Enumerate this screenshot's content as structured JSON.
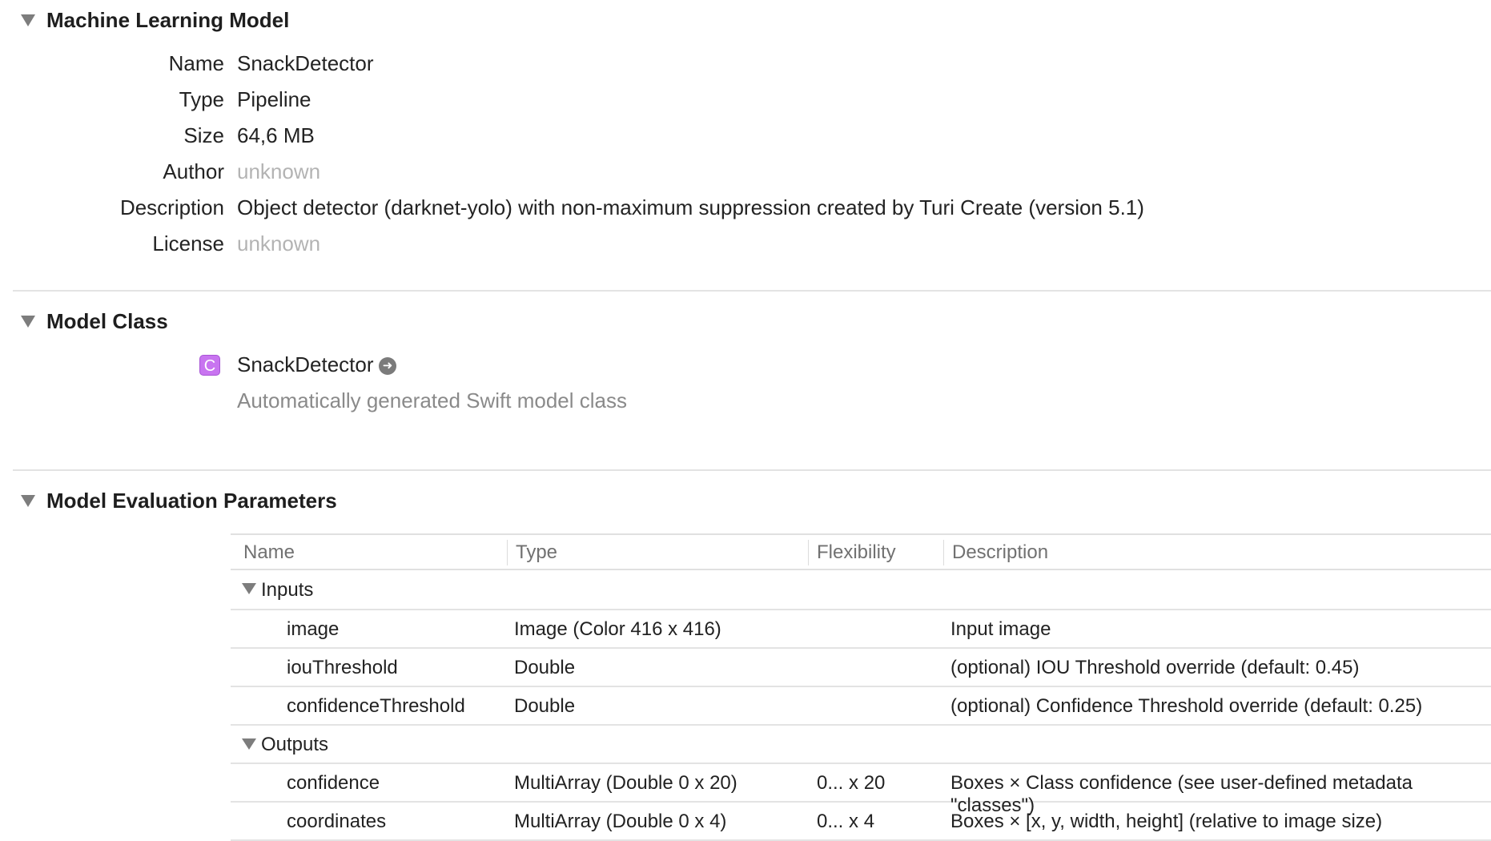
{
  "sections": {
    "ml_model": {
      "title": "Machine Learning Model",
      "rows": [
        {
          "label": "Name",
          "value": "SnackDetector"
        },
        {
          "label": "Type",
          "value": "Pipeline"
        },
        {
          "label": "Size",
          "value": "64,6 MB"
        },
        {
          "label": "Author",
          "value": "unknown"
        },
        {
          "label": "Description",
          "value": "Object detector (darknet-yolo) with non-maximum suppression created by Turi Create (version 5.1)"
        },
        {
          "label": "License",
          "value": "unknown"
        }
      ]
    },
    "model_class": {
      "title": "Model Class",
      "badge": "C",
      "class_name": "SnackDetector",
      "description": "Automatically generated Swift model class",
      "goto_icon": "arrow-circle-right"
    },
    "eval_params": {
      "title": "Model Evaluation Parameters",
      "columns": [
        "Name",
        "Type",
        "Flexibility",
        "Description"
      ],
      "groups": [
        {
          "label": "Inputs",
          "rows": [
            {
              "name": "image",
              "type": "Image (Color 416 x 416)",
              "flexibility": "",
              "description": "Input image"
            },
            {
              "name": "iouThreshold",
              "type": "Double",
              "flexibility": "",
              "description": "(optional) IOU Threshold override (default: 0.45)"
            },
            {
              "name": "confidenceThreshold",
              "type": "Double",
              "flexibility": "",
              "description": "(optional) Confidence Threshold override (default: 0.25)"
            }
          ]
        },
        {
          "label": "Outputs",
          "rows": [
            {
              "name": "confidence",
              "type": "MultiArray (Double 0 x 20)",
              "flexibility": "0... x 20",
              "description": "Boxes × Class confidence (see user-defined metadata \"classes\")"
            },
            {
              "name": "coordinates",
              "type": "MultiArray (Double 0 x 4)",
              "flexibility": "0... x 4",
              "description": "Boxes × [x, y, width, height] (relative to image size)"
            }
          ]
        }
      ]
    }
  },
  "colors": {
    "class_badge": "#c874f0",
    "muted_text": "#b3b3b3",
    "separator": "#e3e3e3"
  }
}
